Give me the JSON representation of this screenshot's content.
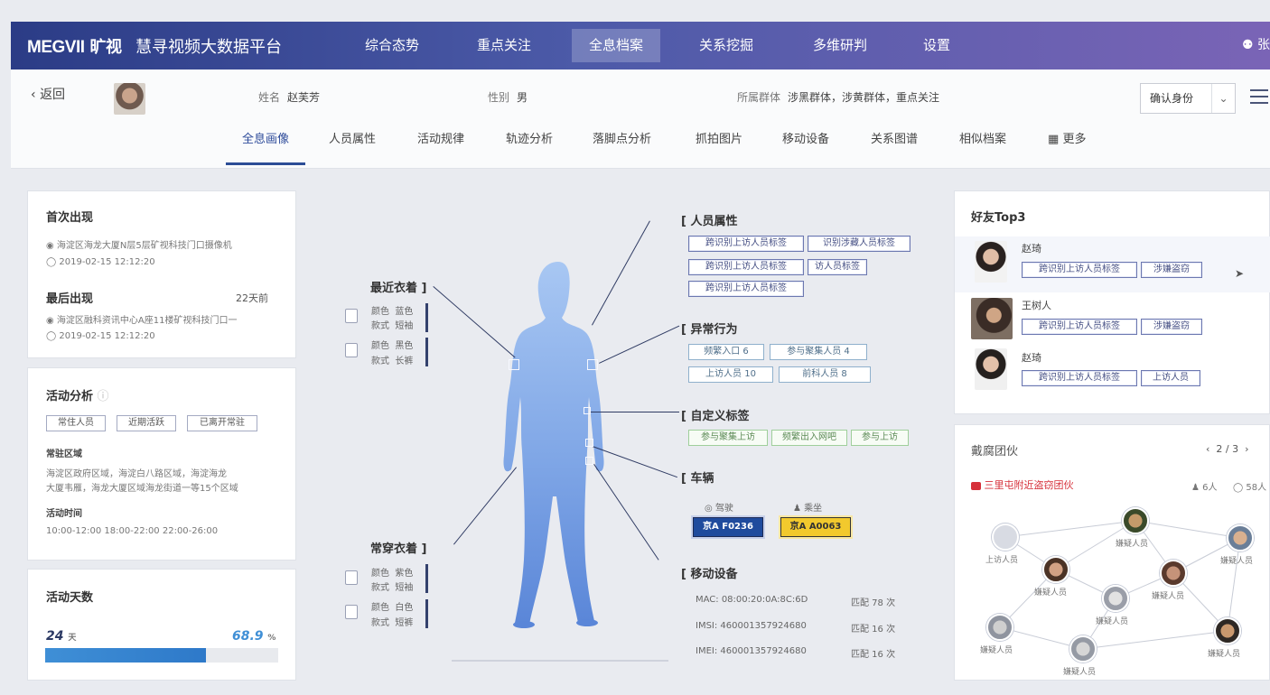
{
  "header": {
    "logo": "MEGVII",
    "logo_cn": "旷视",
    "app_title": "慧寻视频大数据平台",
    "nav": [
      "综合态势",
      "重点关注",
      "全息档案",
      "关系挖掘",
      "多维研判",
      "设置"
    ],
    "active_nav": "全息档案",
    "user": "张"
  },
  "subheader": {
    "back": "返回",
    "name_label": "姓名",
    "name_value": "赵芙芳",
    "gender_label": "性别",
    "gender_value": "男",
    "group_label": "所属群体",
    "group_value": "涉黑群体，涉黄群体，重点关注",
    "confirm_button": "确认身份",
    "tabs": [
      "全息画像",
      "人员属性",
      "活动规律",
      "轨迹分析",
      "落脚点分析",
      "抓拍图片",
      "移动设备",
      "关系图谱",
      "相似档案",
      "更多"
    ],
    "active_tab": "全息画像"
  },
  "left": {
    "first_title": "首次出现",
    "first_location": "海淀区海龙大厦N层5层矿视科技门口摄像机",
    "first_time": "2019-02-15 12:12:20",
    "last_title": "最后出现",
    "last_ago": "22天前",
    "last_location": "海淀区融科资讯中心A座11楼矿视科技门口一",
    "last_time": "2019-02-15 12:12:20",
    "activity_title": "活动分析",
    "activity_tags": [
      "常住人员",
      "近期活跃",
      "已离开常驻"
    ],
    "common_area_label": "常驻区域",
    "common_area_text1": "海淀区政府区域，海淀白八路区域，海淀海龙",
    "common_area_text2": "大厦韦雁，海龙大厦区域海龙街道一等15个区域",
    "active_time_label": "活动时间",
    "active_times": "10:00-12:00   18:00-22:00   22:00-26:00",
    "days_title": "活动天数",
    "days_value": "24",
    "days_unit": "天",
    "ratio_value": "68.9",
    "ratio_unit": "%",
    "ratio_fraction": 0.689
  },
  "center": {
    "recent_clothing_label": "最近衣着",
    "often_clothing_label": "常穿衣着",
    "top_color_label": "颜色",
    "top_color_value": "蓝色",
    "top_style_label": "款式",
    "top_style_value": "短袖",
    "bottom_color_label": "颜色",
    "bottom_color_value": "黑色",
    "bottom_style_label": "款式",
    "bottom_style_value": "长裤",
    "often_top_color": "紫色",
    "often_top_style": "短袖",
    "often_bottom_color": "白色",
    "often_bottom_style": "短裤",
    "attr_label": "人员属性",
    "attr_tags": [
      "跨识别上访人员标签",
      "识别涉藏人员标签",
      "跨识别上访人员标签",
      "访人员标签",
      "跨识别上访人员标签"
    ],
    "abnormal_label": "异常行为",
    "abnormal_tags": [
      "频繁入口 6",
      "参与聚集人员 4",
      "上访人员 10",
      "前科人员 8"
    ],
    "custom_label": "自定义标签",
    "custom_tags": [
      "参与聚集上访",
      "频繁出入网吧",
      "参与上访"
    ],
    "vehicle_label": "车辆",
    "vehicle_driver": "驾驶",
    "vehicle_passenger": "乘坐",
    "plate_blue": "京A F0236",
    "plate_yellow": "京A A0063",
    "mobile_label": "移动设备",
    "devices": [
      {
        "id": "MAC: 08:00:20:0A:8C:6D",
        "match": "匹配 78 次"
      },
      {
        "id": "IMSI: 460001357924680",
        "match": "匹配 16 次"
      },
      {
        "id": "IMEI: 460001357924680",
        "match": "匹配 16 次"
      }
    ]
  },
  "right": {
    "friends_title": "好友Top3",
    "friends": [
      {
        "name": "赵琦",
        "tags": [
          "跨识别上访人员标签",
          "涉嫌盗窃"
        ]
      },
      {
        "name": "王树人",
        "tags": [
          "跨识别上访人员标签",
          "涉嫌盗窃"
        ]
      },
      {
        "name": "赵琦",
        "tags": [
          "跨识别上访人员标签",
          "上访人员"
        ]
      }
    ],
    "network_title": "戴腐团伙",
    "pager": "2 / 3",
    "group_name": "三里屯附近盗窃团伙",
    "group_members": "6人",
    "group_count": "58人",
    "nodes": [
      "上访人员",
      "嫌疑人员",
      "嫌疑人员",
      "嫌疑人员",
      "嫌疑人员",
      "嫌疑人员",
      "嫌疑人员",
      "嫌疑人员",
      "嫌疑人员",
      "嫌疑人员"
    ]
  }
}
